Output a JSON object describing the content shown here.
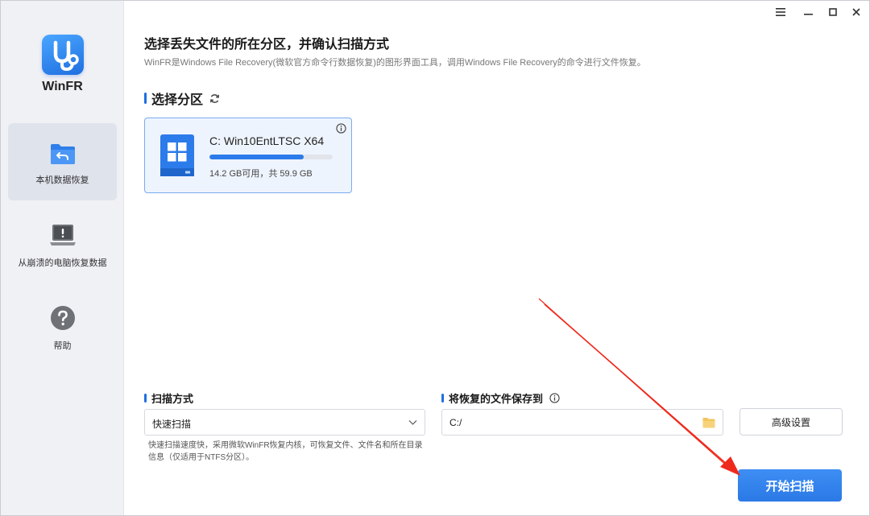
{
  "app": {
    "name": "WinFR",
    "brand_color": "#2b7bea"
  },
  "window_controls": {
    "menu_icon": "hamburger-icon",
    "minimize_icon": "minimize-icon",
    "maximize_icon": "maximize-icon",
    "close_icon": "close-icon"
  },
  "sidebar": {
    "items": [
      {
        "label": "本机数据恢复",
        "icon": "folder-back-icon",
        "active": true
      },
      {
        "label": "从崩溃的电脑恢复数据",
        "icon": "crashed-laptop-icon",
        "active": false
      },
      {
        "label": "帮助",
        "icon": "help-icon",
        "active": false
      }
    ]
  },
  "main": {
    "title": "选择丢失文件的所在分区，并确认扫描方式",
    "description": "WinFR是Windows File Recovery(微软官方命令行数据恢复)的图形界面工具，调用Windows File Recovery的命令进行文件恢复。",
    "partition_section": {
      "label": "选择分区",
      "refresh_icon": "refresh-icon"
    },
    "drive": {
      "name": "C: Win10EntLTSC X64",
      "size_text": "14.2 GB可用，共 59.9 GB",
      "used_fraction": 0.763
    },
    "scan_section": {
      "label": "扫描方式",
      "selected": "快速扫描",
      "description": "快速扫描速度快，采用微软WinFR恢复内核，可恢复文件、文件名和所在目录信息（仅适用于NTFS分区）。"
    },
    "save_section": {
      "label": "将恢复的文件保存到",
      "path": "C:/"
    },
    "advanced_button": "高级设置",
    "start_button": "开始扫描"
  }
}
